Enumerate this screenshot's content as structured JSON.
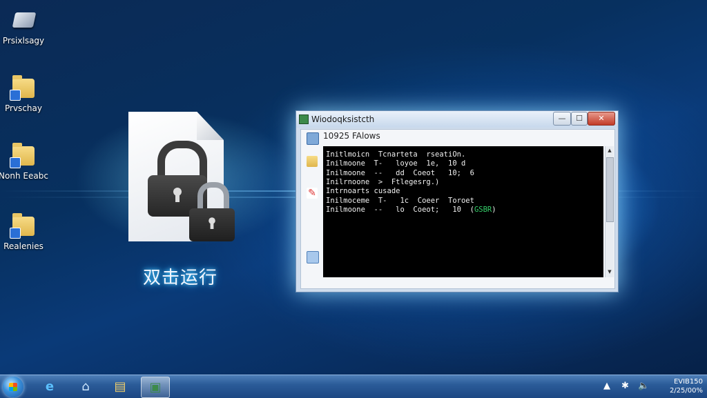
{
  "desktop": {
    "icons": [
      {
        "label": "Prsixlsagy",
        "icon": "drive-icon"
      },
      {
        "label": "Prvschay",
        "icon": "folder-icon"
      },
      {
        "label": "Nonh Eeabc",
        "icon": "folder-icon"
      },
      {
        "label": "Realenies",
        "icon": "folder-icon"
      }
    ],
    "lock_file": {
      "label": "双击运行",
      "icon": "lock-file-icon"
    }
  },
  "window": {
    "title": "Wiodoqksistcth",
    "inner_title": "10925 FAlows",
    "buttons": {
      "minimize": "—",
      "maximize": "☐",
      "close": "✕"
    },
    "console_lines": [
      "Initlmoicn  Tcnarteta  rseatiOn.",
      "Inilmoone  T-   loyoe  1e,  10 d",
      "Inilmoone  --   dd  Coeot   10;  6",
      "Inilrnoone  >  Ftlegesrg.)",
      "Intrnoarts cusade",
      "Inilmoceme  T-   1c  Coeer  Toroet",
      "Inilmoone  --   lo  Coeot;   10  ("
    ],
    "console_highlight": "GSBR",
    "console_tail": ")"
  },
  "taskbar": {
    "apps": [
      {
        "name": "internet-explorer-icon",
        "glyph": "e"
      },
      {
        "name": "network-icon",
        "glyph": "⌂"
      },
      {
        "name": "file-explorer-icon",
        "glyph": "▤"
      },
      {
        "name": "active-app-icon",
        "glyph": "▣"
      }
    ],
    "tray_icons": [
      "▲",
      "✱",
      "🔈"
    ],
    "clock_time": "EVIB150",
    "clock_date": "2/25/00%"
  },
  "colors": {
    "accent": "#2a8fe0",
    "console_bg": "#000000",
    "console_text": "#f0f0f0",
    "console_highlight": "#35d06a"
  }
}
